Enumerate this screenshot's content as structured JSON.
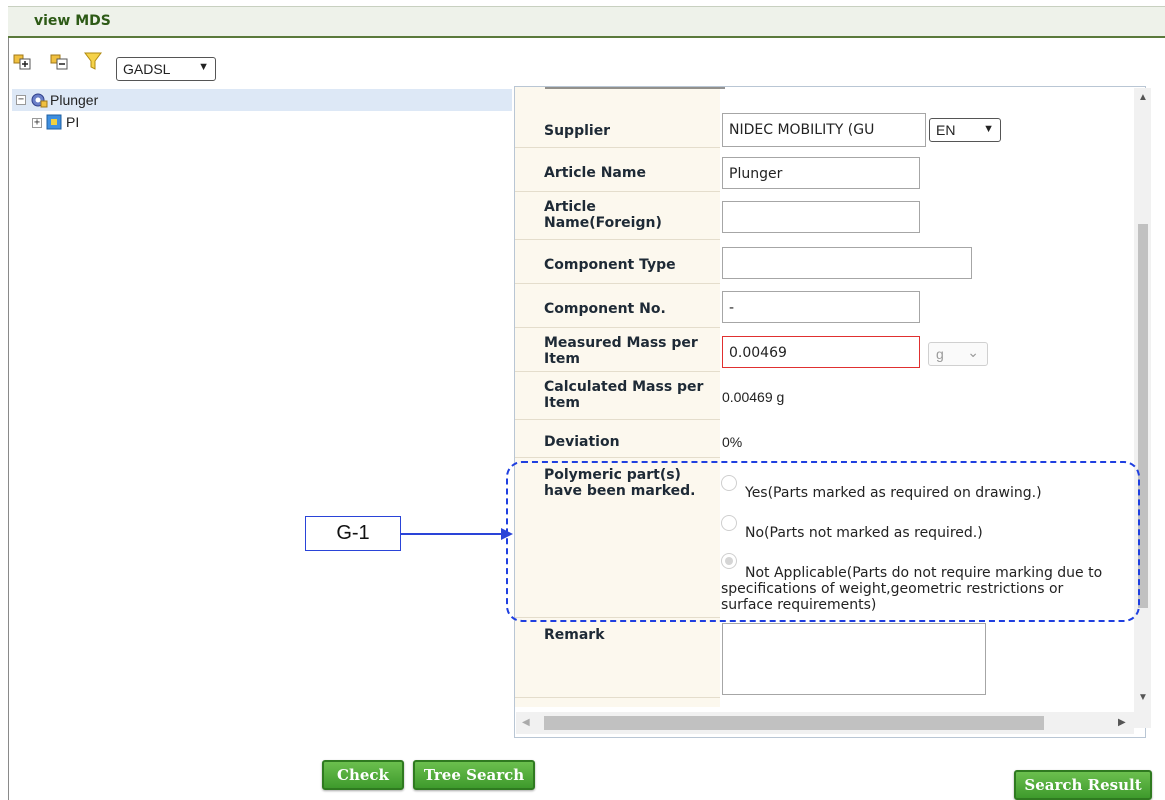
{
  "window": {
    "title": "view MDS"
  },
  "toolbar": {
    "expand_icon": "expand-all-icon",
    "collapse_icon": "collapse-all-icon",
    "filter_icon": "filter-icon",
    "standard_select": "GADSL"
  },
  "tree": {
    "root": {
      "label": "Plunger",
      "icon": "component-gear-icon"
    },
    "child": {
      "label": "PI",
      "icon": "material-icon"
    }
  },
  "form": {
    "supplier": {
      "label": "Supplier",
      "value": "NIDEC MOBILITY (GU",
      "lang": "EN"
    },
    "article_name": {
      "label": "Article Name",
      "value": "Plunger"
    },
    "article_name_foreign": {
      "label_line1": "Article",
      "label_line2": "Name(Foreign)",
      "value": ""
    },
    "component_type": {
      "label": "Component Type",
      "value": ""
    },
    "component_no": {
      "label": "Component No.",
      "value": "-"
    },
    "measured_mass": {
      "label_line1": "Measured Mass per",
      "label_line2": "Item",
      "value": "0.00469",
      "unit": "g"
    },
    "calculated_mass": {
      "label_line1": "Calculated Mass per",
      "label_line2": "Item",
      "value": "0.00469 g"
    },
    "deviation": {
      "label": "Deviation",
      "value": "0%"
    },
    "polymeric": {
      "label_line1": "Polymeric part(s)",
      "label_line2": "have been marked.",
      "options": [
        {
          "line1": "Yes(Parts marked as required on drawing.)",
          "selected": false
        },
        {
          "line1": "No(Parts not marked as required.)",
          "selected": false
        },
        {
          "line1": "Not Applicable(Parts do not require marking due to",
          "line2": "specifications of weight,geometric restrictions or",
          "line3": "surface requirements)",
          "selected": true
        }
      ]
    },
    "remark": {
      "label": "Remark",
      "value": ""
    }
  },
  "annotation": {
    "label": "G-1",
    "color": "#2a44d8"
  },
  "buttons": {
    "check": "Check",
    "tree_search": "Tree Search",
    "search_result": "Search Result"
  },
  "colors": {
    "accent_green": "#3e9a2c",
    "title_text": "#2d5a16",
    "selection": "#dde8f6",
    "mass_border_error": "#e03030"
  }
}
